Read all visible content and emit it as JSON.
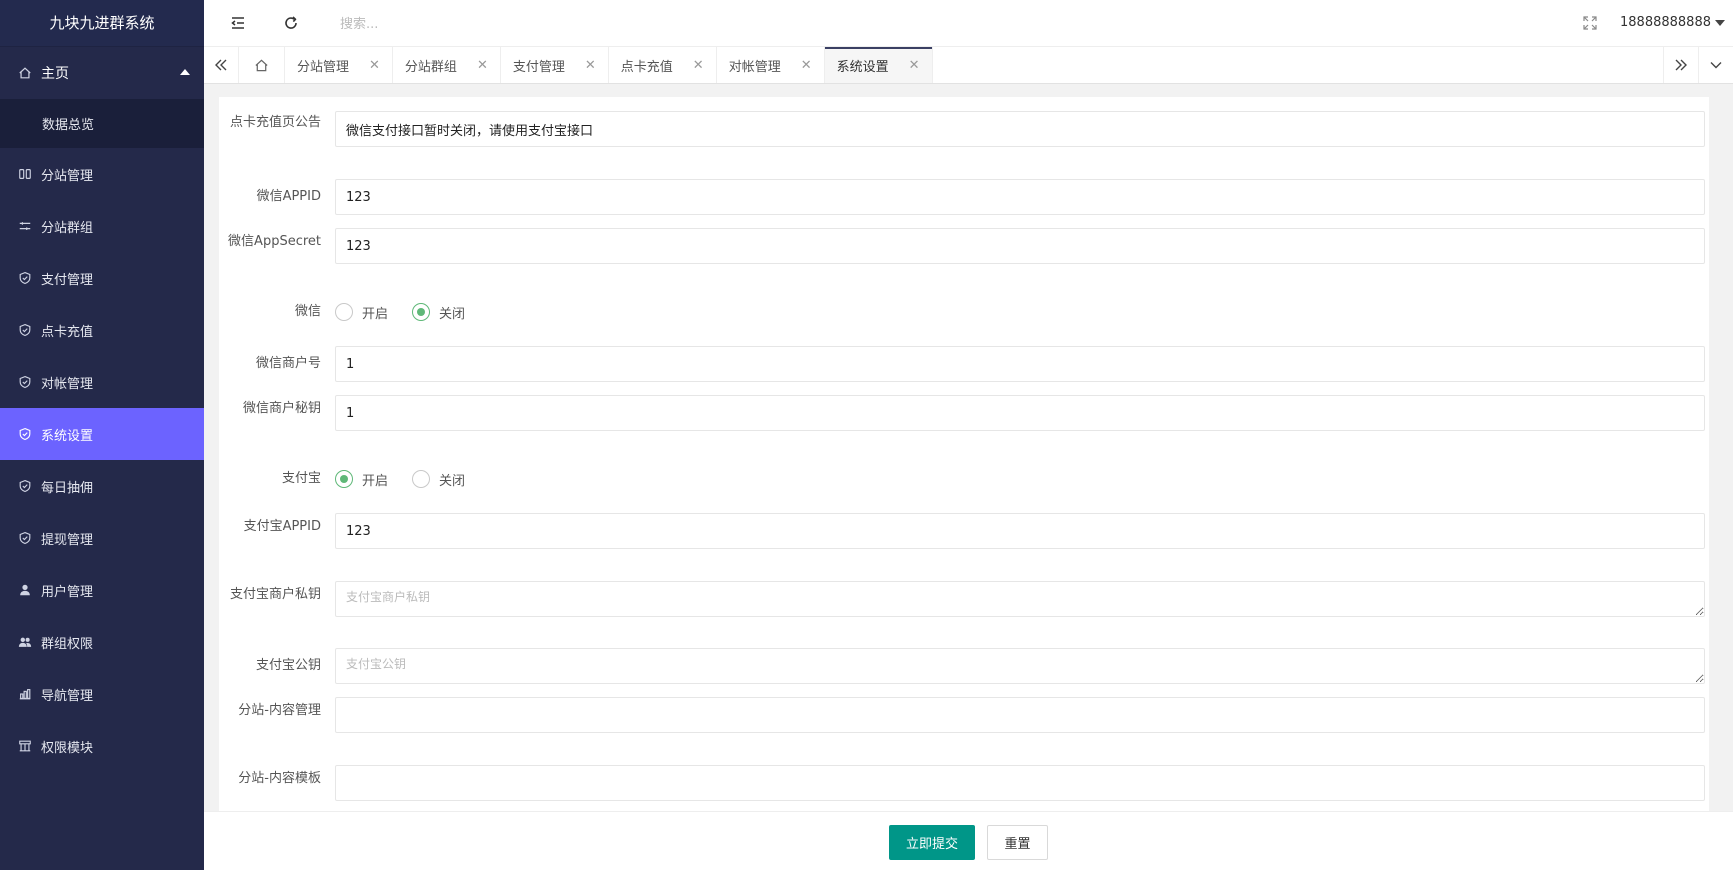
{
  "app": {
    "title": "九块九进群系统"
  },
  "sidebar": {
    "home": {
      "label": "主页",
      "sub_items": [
        {
          "label": "数据总览"
        }
      ]
    },
    "items": [
      {
        "label": "分站管理",
        "icon": "columns-icon"
      },
      {
        "label": "分站群组",
        "icon": "sliders-icon"
      },
      {
        "label": "支付管理",
        "icon": "shield-check-icon"
      },
      {
        "label": "点卡充值",
        "icon": "shield-check-icon"
      },
      {
        "label": "对帐管理",
        "icon": "shield-check-icon"
      },
      {
        "label": "系统设置",
        "icon": "shield-check-icon",
        "active": true
      },
      {
        "label": "每日抽佣",
        "icon": "shield-check-icon"
      },
      {
        "label": "提现管理",
        "icon": "shield-check-icon"
      },
      {
        "label": "用户管理",
        "icon": "user-icon"
      },
      {
        "label": "群组权限",
        "icon": "users-icon"
      },
      {
        "label": "导航管理",
        "icon": "chart-icon"
      },
      {
        "label": "权限模块",
        "icon": "modules-icon"
      }
    ],
    "active_color": "#6c63ff"
  },
  "header": {
    "search_placeholder": "搜索...",
    "username": "18888888888"
  },
  "tabs": [
    {
      "label": "分站管理"
    },
    {
      "label": "分站群组"
    },
    {
      "label": "支付管理"
    },
    {
      "label": "点卡充值"
    },
    {
      "label": "对帐管理"
    },
    {
      "label": "系统设置",
      "active": true
    }
  ],
  "form": {
    "notice": {
      "label": "点卡充值页公告",
      "value": "微信支付接口暂时关闭，请使用支付宝接口"
    },
    "wechat_appid": {
      "label": "微信APPID",
      "value": "123"
    },
    "wechat_appsecret": {
      "label": "微信AppSecret",
      "value": "123"
    },
    "wechat": {
      "label": "微信",
      "options": [
        "开启",
        "关闭"
      ],
      "selected": "关闭"
    },
    "wechat_mch_id": {
      "label": "微信商户号",
      "value": "1"
    },
    "wechat_mch_key": {
      "label": "微信商户秘钥",
      "value": "1"
    },
    "alipay": {
      "label": "支付宝",
      "options": [
        "开启",
        "关闭"
      ],
      "selected": "开启"
    },
    "alipay_appid": {
      "label": "支付宝APPID",
      "value": "123"
    },
    "alipay_private_key": {
      "label": "支付宝商户私钥",
      "placeholder": "支付宝商户私钥",
      "value": ""
    },
    "alipay_public_key": {
      "label": "支付宝公钥",
      "placeholder": "支付宝公钥",
      "value": ""
    },
    "content_manage": {
      "label": "分站-内容管理",
      "value": ""
    },
    "content_template": {
      "label": "分站-内容模板",
      "value": ""
    }
  },
  "footer": {
    "submit_label": "立即提交",
    "reset_label": "重置",
    "submit_color": "#009688"
  }
}
